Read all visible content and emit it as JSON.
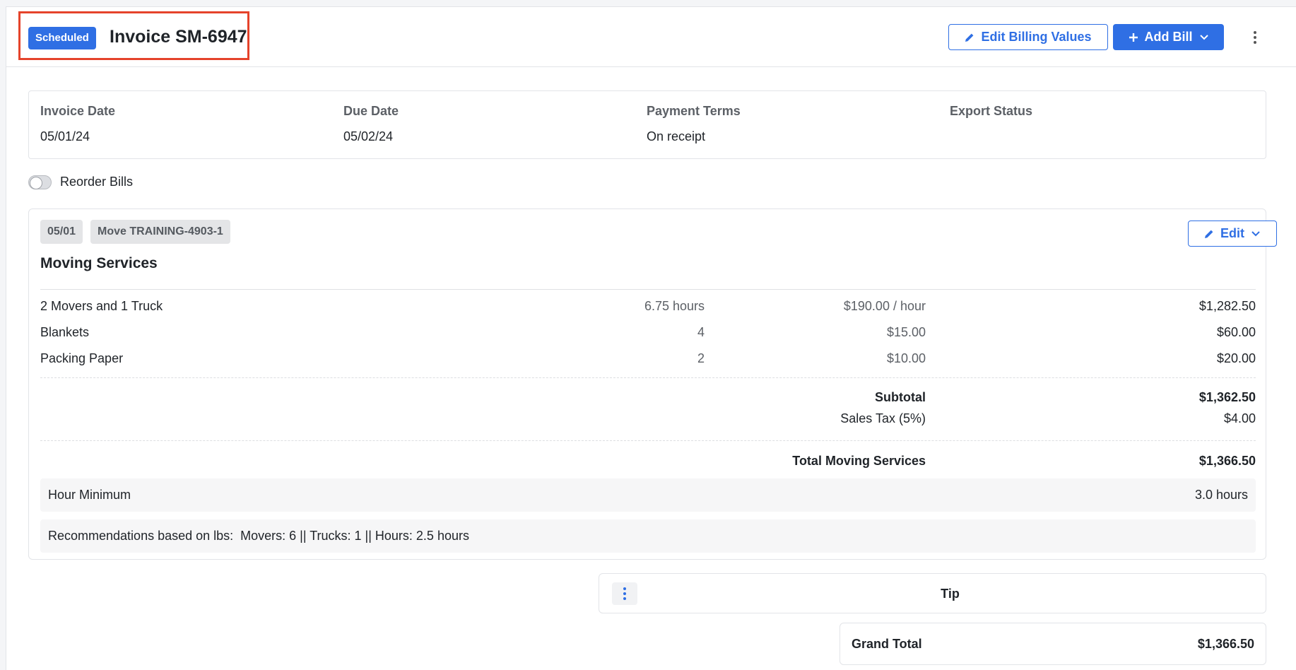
{
  "header": {
    "status_badge": "Scheduled",
    "title": "Invoice SM-6947",
    "edit_billing_label": "Edit Billing Values",
    "add_bill_label": "Add Bill"
  },
  "info": {
    "invoice_date_label": "Invoice Date",
    "invoice_date_value": "05/01/24",
    "due_date_label": "Due Date",
    "due_date_value": "05/02/24",
    "payment_terms_label": "Payment Terms",
    "payment_terms_value": "On receipt",
    "export_status_label": "Export Status",
    "export_status_value": ""
  },
  "reorder": {
    "label": "Reorder Bills",
    "enabled": false
  },
  "bill": {
    "date_chip": "05/01",
    "move_chip": "Move TRAINING-4903-1",
    "edit_label": "Edit",
    "title": "Moving Services",
    "items": [
      {
        "description": "2 Movers and 1 Truck",
        "quantity": "6.75 hours",
        "rate": "$190.00 / hour",
        "amount": "$1,282.50"
      },
      {
        "description": "Blankets",
        "quantity": "4",
        "rate": "$15.00",
        "amount": "$60.00"
      },
      {
        "description": "Packing Paper",
        "quantity": "2",
        "rate": "$10.00",
        "amount": "$20.00"
      }
    ],
    "subtotal_label": "Subtotal",
    "subtotal_value": "$1,362.50",
    "tax_label": "Sales Tax (5%)",
    "tax_value": "$4.00",
    "total_label": "Total Moving Services",
    "total_value": "$1,366.50",
    "hour_minimum_label": "Hour Minimum",
    "hour_minimum_value": "3.0 hours",
    "recommendations": "Recommendations based on lbs:  Movers: 6 || Trucks: 1 || Hours: 2.5 hours"
  },
  "tip": {
    "label": "Tip"
  },
  "grand_total": {
    "label": "Grand Total",
    "value": "$1,366.50"
  },
  "colors": {
    "primary": "#2f6fe4",
    "highlight": "#e5432b"
  },
  "icons": [
    "pencil-icon",
    "plus-icon",
    "chevron-down-icon",
    "more-vertical-icon"
  ]
}
